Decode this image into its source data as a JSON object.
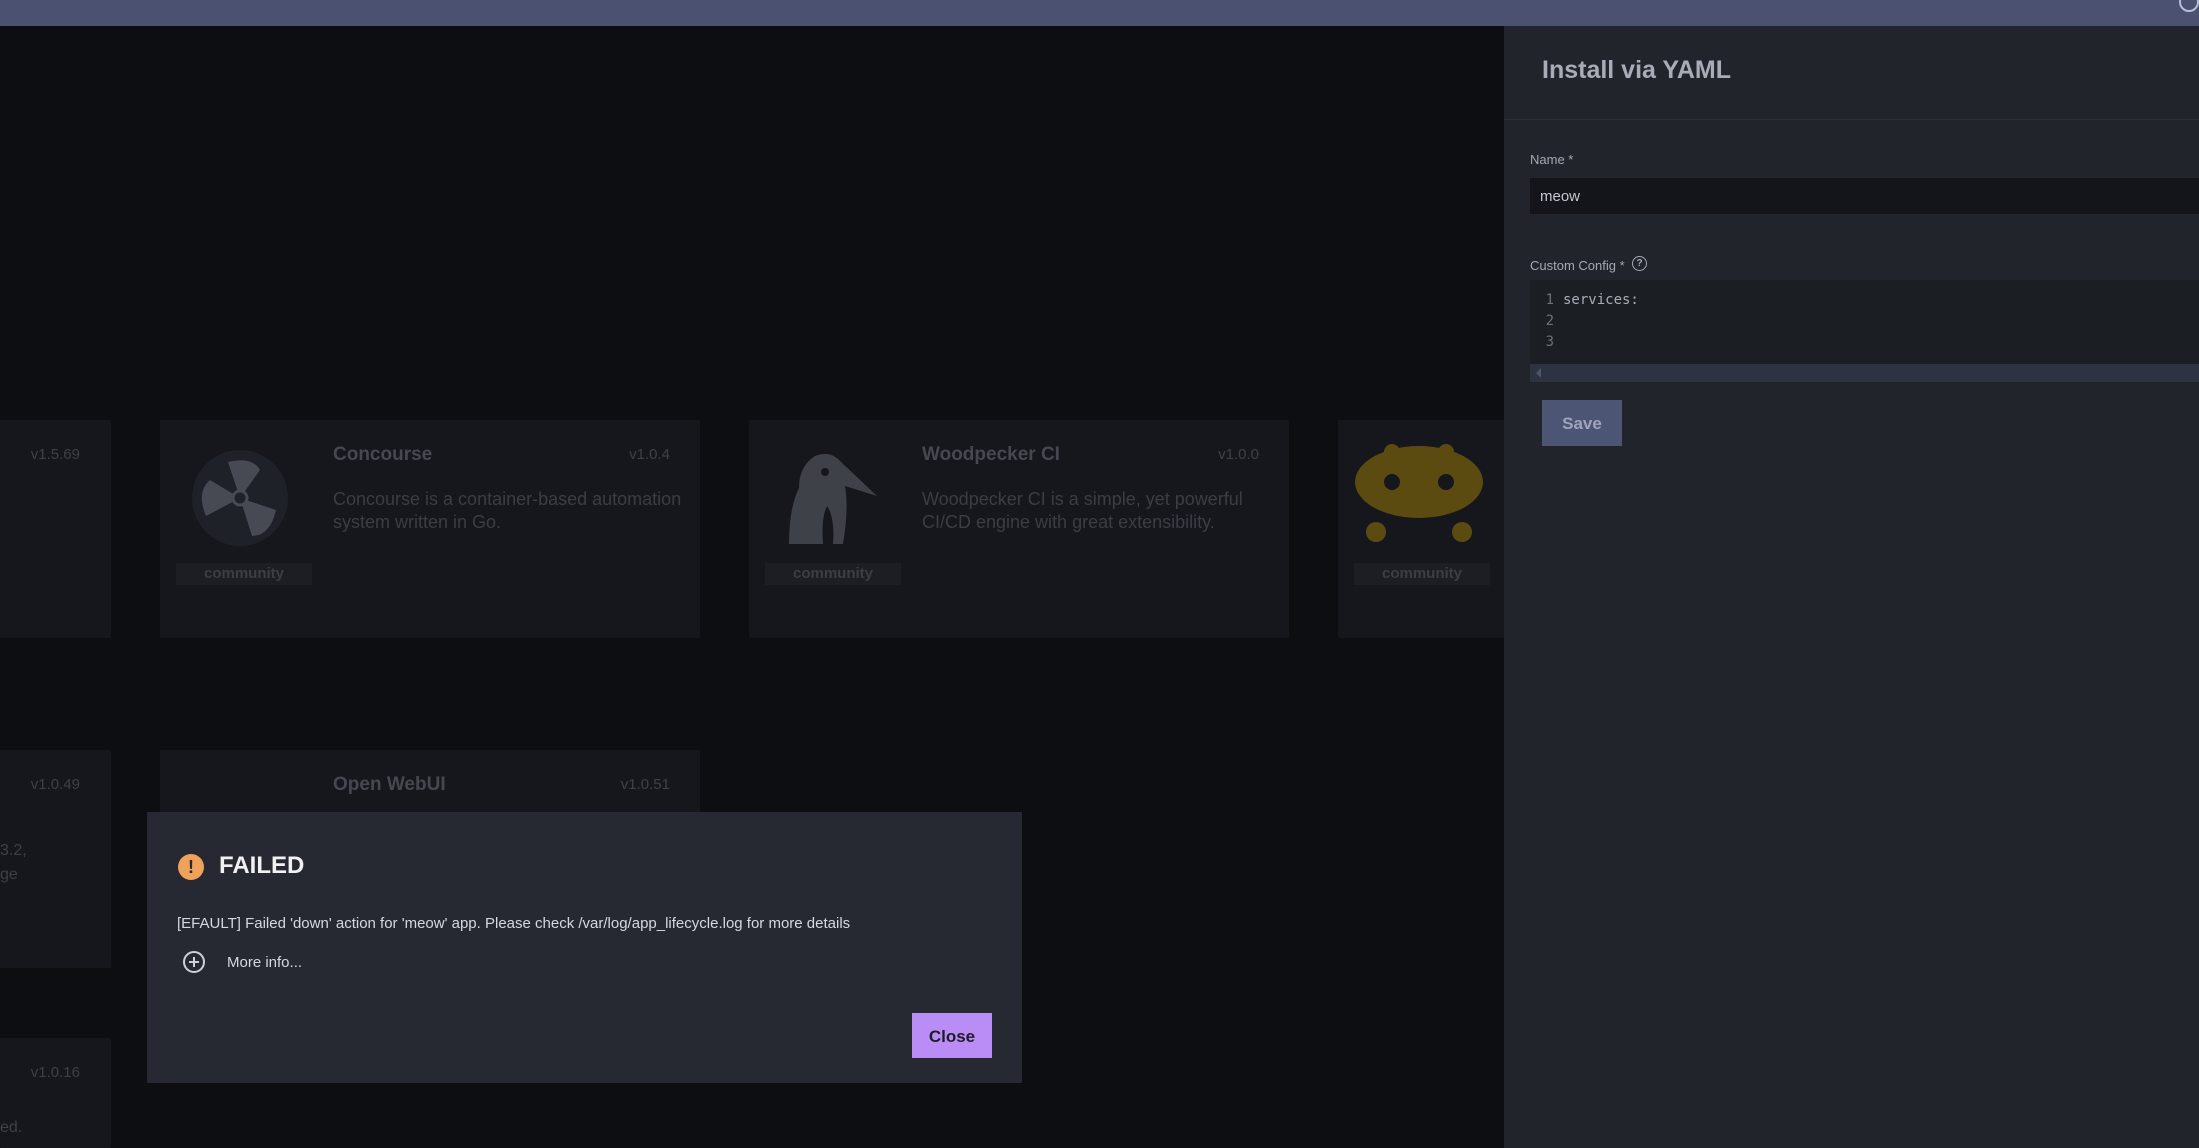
{
  "install_panel": {
    "title": "Install via YAML",
    "name_label": "Name *",
    "name_value": "meow",
    "config_label": "Custom Config *",
    "help_icon": "question-circle-icon",
    "editor": {
      "line_numbers": [
        "1",
        "2",
        "3"
      ],
      "lines": [
        "services:",
        "",
        ""
      ]
    },
    "save_label": "Save"
  },
  "app_cards": [
    {
      "name": "Concourse",
      "version": "v1.0.4",
      "description": "Concourse is a container-based automation system written in Go.",
      "badge": "community",
      "icon": "propeller-logo-icon"
    },
    {
      "name": "Woodpecker CI",
      "version": "v1.0.0",
      "description": "Woodpecker CI is a simple, yet powerful CI/CD engine with great extensibility.",
      "badge": "community",
      "icon": "woodpecker-logo-icon"
    },
    {
      "badge": "community",
      "icon": "app-logo-icon"
    },
    {
      "name": "Open WebUI",
      "version": "v1.0.51"
    }
  ],
  "partial_cards": {
    "versions": [
      "v1.5.69",
      "v1.0.49",
      "v1.0.16"
    ],
    "text_fragments": [
      "3.2,",
      "ge",
      "ed."
    ]
  },
  "error_dialog": {
    "icon": "warning-circle-icon",
    "title": "FAILED",
    "message": "[EFAULT] Failed 'down' action for 'meow' app. Please check /var/log/app_lifecycle.log for more details",
    "more_info_icon": "plus-circle-icon",
    "more_info_label": "More info...",
    "close_label": "Close"
  },
  "colors": {
    "accent": "#ba8cf6",
    "warning": "#f0a15a",
    "topbar": "#4b5271",
    "save_button": "#4d5575"
  }
}
